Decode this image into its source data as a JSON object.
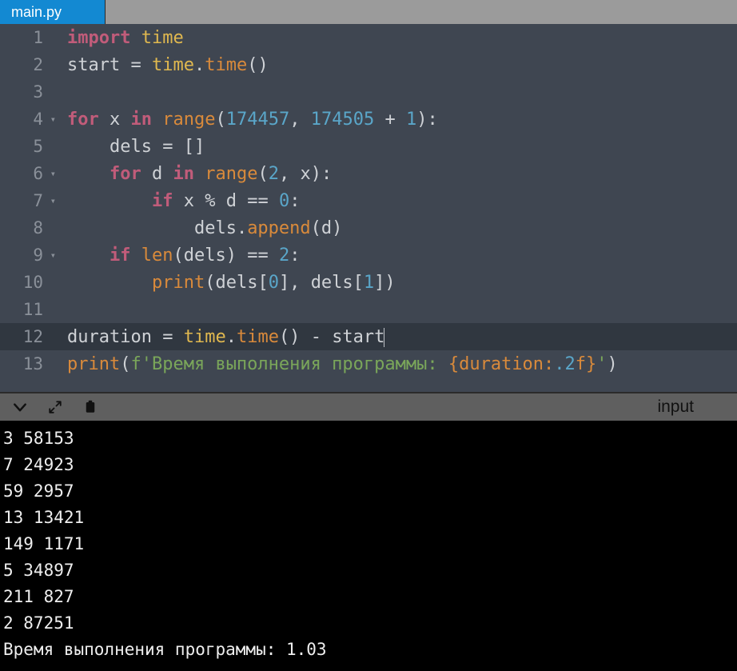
{
  "tab": {
    "filename": "main.py"
  },
  "code_lines": [
    {
      "n": 1,
      "fold": "",
      "html": "<span class='kw'>import</span> <span class='bi'>time</span>"
    },
    {
      "n": 2,
      "fold": "",
      "html": "<span class='var'>start</span> <span class='op'>=</span> <span class='bi'>time</span><span class='punc'>.</span><span class='fn'>time</span><span class='punc'>()</span>"
    },
    {
      "n": 3,
      "fold": "",
      "html": ""
    },
    {
      "n": 4,
      "fold": "▾",
      "html": "<span class='kw'>for</span> <span class='var'>x</span> <span class='kw'>in</span> <span class='fn'>range</span><span class='punc'>(</span><span class='num'>174457</span><span class='punc'>,</span> <span class='num'>174505</span> <span class='op'>+</span> <span class='num'>1</span><span class='punc'>):</span>"
    },
    {
      "n": 5,
      "fold": "",
      "html": "    <span class='var'>dels</span> <span class='op'>=</span> <span class='punc'>[]</span>"
    },
    {
      "n": 6,
      "fold": "▾",
      "html": "    <span class='kw'>for</span> <span class='var'>d</span> <span class='kw'>in</span> <span class='fn'>range</span><span class='punc'>(</span><span class='num'>2</span><span class='punc'>,</span> <span class='var'>x</span><span class='punc'>):</span>"
    },
    {
      "n": 7,
      "fold": "▾",
      "html": "        <span class='kw'>if</span> <span class='var'>x</span> <span class='op'>%</span> <span class='var'>d</span> <span class='op'>==</span> <span class='num'>0</span><span class='punc'>:</span>"
    },
    {
      "n": 8,
      "fold": "",
      "html": "            <span class='var'>dels</span><span class='punc'>.</span><span class='fn'>append</span><span class='punc'>(</span><span class='var'>d</span><span class='punc'>)</span>"
    },
    {
      "n": 9,
      "fold": "▾",
      "html": "    <span class='kw'>if</span> <span class='fn'>len</span><span class='punc'>(</span><span class='var'>dels</span><span class='punc'>)</span> <span class='op'>==</span> <span class='num'>2</span><span class='punc'>:</span>"
    },
    {
      "n": 10,
      "fold": "",
      "html": "        <span class='fn'>print</span><span class='punc'>(</span><span class='var'>dels</span><span class='punc'>[</span><span class='num'>0</span><span class='punc'>],</span> <span class='var'>dels</span><span class='punc'>[</span><span class='num'>1</span><span class='punc'>])</span>"
    },
    {
      "n": 11,
      "fold": "",
      "html": ""
    },
    {
      "n": 12,
      "fold": "",
      "current": true,
      "html": "<span class='var'>duration</span> <span class='op'>=</span> <span class='bi'>time</span><span class='punc'>.</span><span class='fn'>time</span><span class='punc'>()</span> <span class='op'>-</span> <span class='var'>start</span><span class='cursor'></span>"
    },
    {
      "n": 13,
      "fold": "",
      "html": "<span class='fn'>print</span><span class='punc'>(</span><span class='str'>f'Время выполнения программы: </span><span class='fmt'>{duration:</span><span class='num'>.2</span><span class='fmt'>f}</span><span class='str'>'</span><span class='punc'>)</span>"
    }
  ],
  "console": {
    "input_label": "input"
  },
  "output_lines": [
    "3 58153",
    "7 24923",
    "59 2957",
    "13 13421",
    "149 1171",
    "5 34897",
    "211 827",
    "2 87251",
    "Время выполнения программы: 1.03"
  ]
}
